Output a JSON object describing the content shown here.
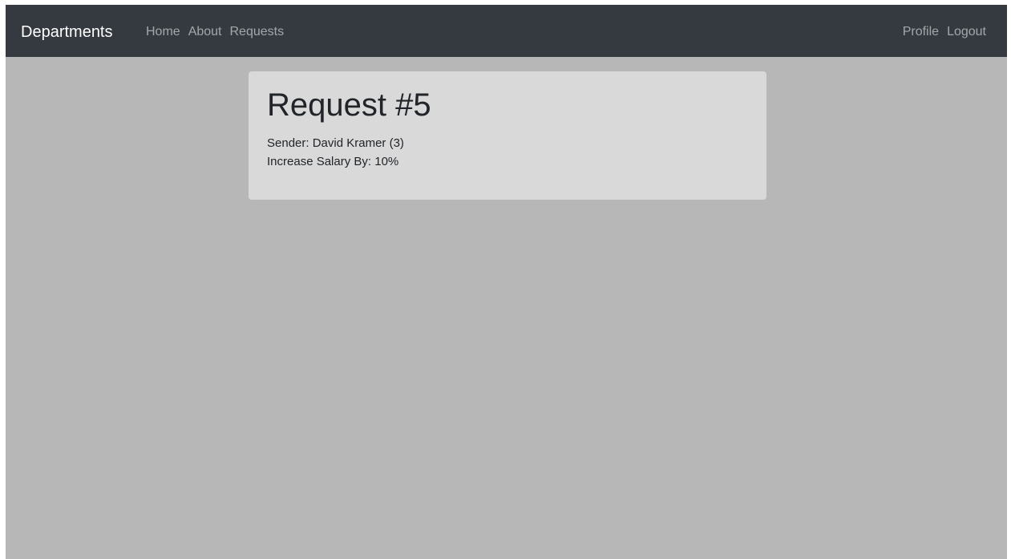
{
  "navbar": {
    "brand": "Departments",
    "left_links": [
      "Home",
      "About",
      "Requests"
    ],
    "right_links": [
      "Profile",
      "Logout"
    ]
  },
  "request": {
    "title": "Request #5",
    "sender_label": "Sender:",
    "sender_value": "David Kramer (3)",
    "increase_label": "Increase Salary By:",
    "increase_value": "10%"
  },
  "colors": {
    "navbar_bg": "#343a40",
    "page_bg": "#b7b7b7",
    "card_bg": "#d9d9d9",
    "text": "#212529"
  }
}
